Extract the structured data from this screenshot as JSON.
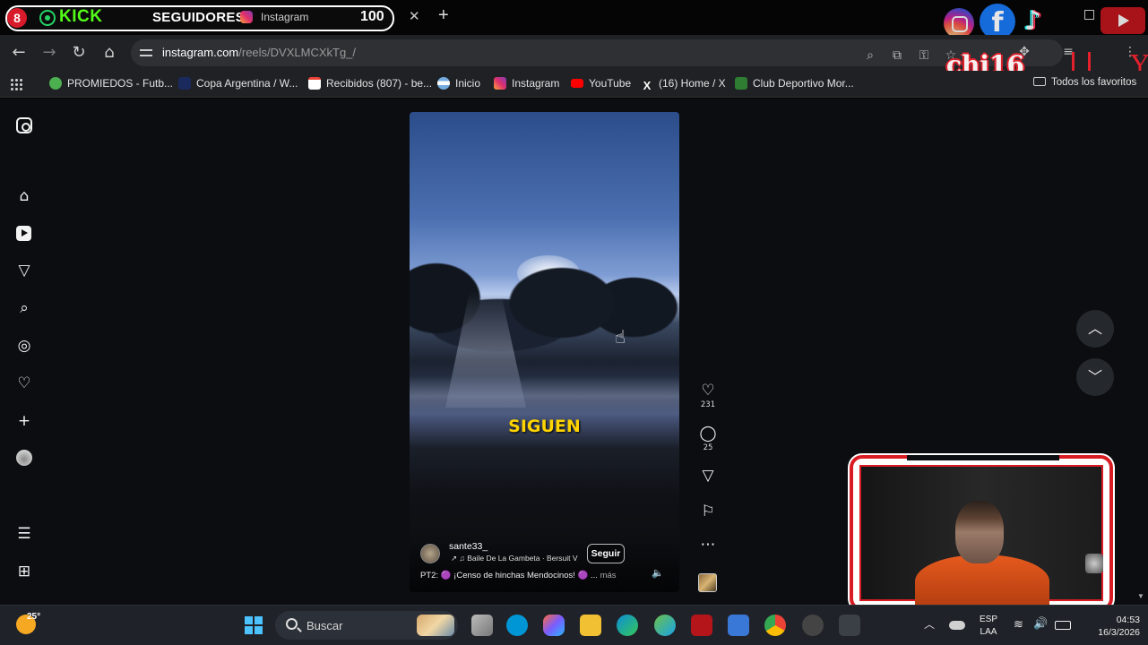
{
  "overlay": {
    "badge": "8",
    "kick_label": "KICK",
    "seguidores_label": "SEGUIDORES",
    "counter": "100",
    "channel_tag": "chi16"
  },
  "tabs": [
    {
      "title": "Instagram",
      "active": true,
      "icon": "instagram-icon"
    }
  ],
  "address_bar": {
    "host": "instagram.com",
    "path": "/reels/DVXLMCXkTg_/"
  },
  "bookmarks": [
    {
      "label": "PROMIEDOS - Futb...",
      "icon": "promiedos-icon",
      "color": "#4caf50"
    },
    {
      "label": "Copa Argentina / W...",
      "icon": "copa-argentina-icon",
      "color": "#1b2a5c"
    },
    {
      "label": "Recibidos (807) - be...",
      "icon": "gmail-icon",
      "color": "#ea4335"
    },
    {
      "label": "Inicio",
      "icon": "argentina-flag-icon",
      "color": "#74acdf"
    },
    {
      "label": "Instagram",
      "icon": "instagram-icon",
      "color": "#e1306c"
    },
    {
      "label": "YouTube",
      "icon": "youtube-icon",
      "color": "#ff0000"
    },
    {
      "label": "(16) Home / X",
      "icon": "x-icon",
      "color": "#ffffff"
    },
    {
      "label": "Club Deportivo Mor...",
      "icon": "club-icon",
      "color": "#2e7d32"
    }
  ],
  "bookmarks_all": "Todos los favoritos",
  "reel": {
    "overlay_text": "SIGUEN",
    "author": "sante33_",
    "audio": "↗ ♫ Baile De La Gambeta · Bersuit V",
    "follow_label": "Seguir",
    "caption": "PT2: 🟣 ¡Censo de hinchas Mendocinos! 🟣 ...",
    "caption_more": "más"
  },
  "actions": {
    "likes": "231",
    "comments": "25"
  },
  "taskbar": {
    "temperature": "25°",
    "search_label": "Buscar",
    "lang_line1": "ESP",
    "lang_line2": "LAA",
    "time": "04:53",
    "date": "16/3/2026"
  }
}
